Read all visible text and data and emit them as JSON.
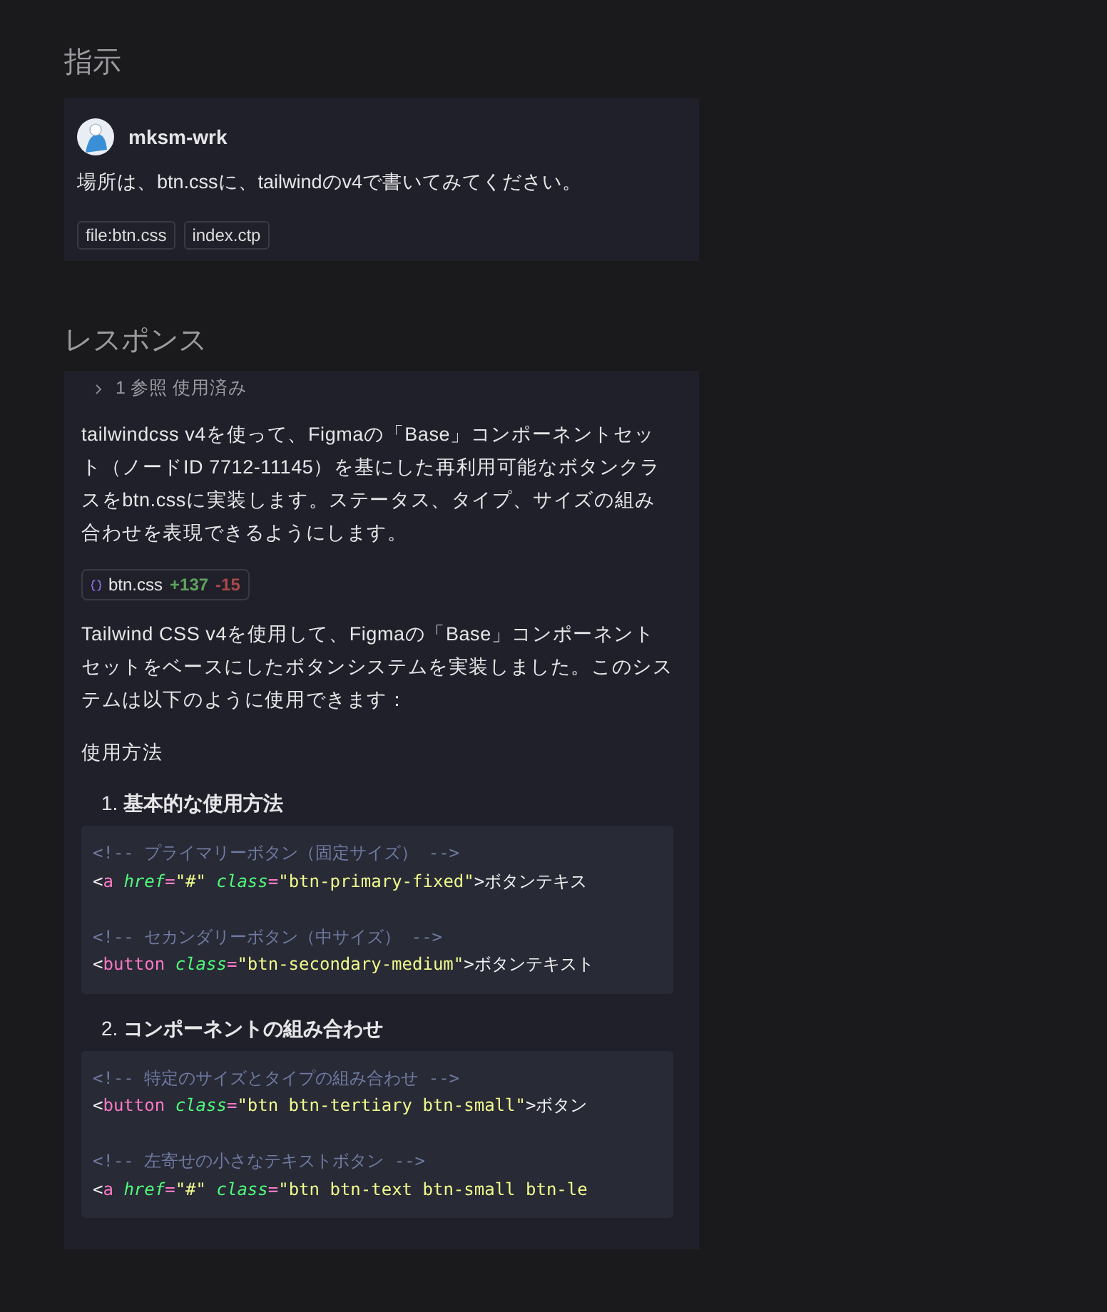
{
  "instruction": {
    "heading": "指示",
    "user": "mksm-wrk",
    "message": "場所は、btn.cssに、tailwindのv4で書いてみてください。",
    "tags": [
      "file:btn.css",
      "index.ctp"
    ]
  },
  "response": {
    "heading": "レスポンス",
    "references": {
      "label": "1 参照 使用済み",
      "expanded": false
    },
    "intro": "tailwindcss v4を使って、Figmaの「Base」コンポーネントセット（ノードID 7712-11145）を基にした再利用可能なボタンクラスをbtn.cssに実装します。ステータス、タイプ、サイズの組み合わせを表現できるようにします。",
    "file_change": {
      "name": "btn.css",
      "added": "+137",
      "removed": "-15"
    },
    "summary": "Tailwind CSS v4を使用して、Figmaの「Base」コンポーネントセットをベースにしたボタンシステムを実装しました。このシステムは以下のように使用できます：",
    "usage_heading": "使用方法",
    "sections": [
      {
        "number": "1.",
        "title": "基本的な使用方法",
        "code_groups": [
          [
            [
              {
                "kind": "comment",
                "text": "<!-- プライマリーボタン（固定サイズ） -->"
              }
            ],
            [
              {
                "kind": "punct",
                "text": "<"
              },
              {
                "kind": "tag",
                "text": "a"
              },
              {
                "kind": "attr",
                "text": " href"
              },
              {
                "kind": "op",
                "text": "="
              },
              {
                "kind": "string",
                "text": "\"#\""
              },
              {
                "kind": "attr",
                "text": " class"
              },
              {
                "kind": "op",
                "text": "="
              },
              {
                "kind": "string",
                "text": "\"btn-primary-fixed\""
              },
              {
                "kind": "punct",
                "text": ">ボタンテキス"
              }
            ]
          ],
          [
            [
              {
                "kind": "comment",
                "text": "<!-- セカンダリーボタン（中サイズ） -->"
              }
            ],
            [
              {
                "kind": "punct",
                "text": "<"
              },
              {
                "kind": "tag",
                "text": "button"
              },
              {
                "kind": "attr",
                "text": " class"
              },
              {
                "kind": "op",
                "text": "="
              },
              {
                "kind": "string",
                "text": "\"btn-secondary-medium\""
              },
              {
                "kind": "punct",
                "text": ">ボタンテキスト"
              }
            ]
          ]
        ]
      },
      {
        "number": "2.",
        "title": "コンポーネントの組み合わせ",
        "code_groups": [
          [
            [
              {
                "kind": "comment",
                "text": "<!-- 特定のサイズとタイプの組み合わせ -->"
              }
            ],
            [
              {
                "kind": "punct",
                "text": "<"
              },
              {
                "kind": "tag",
                "text": "button"
              },
              {
                "kind": "attr",
                "text": " class"
              },
              {
                "kind": "op",
                "text": "="
              },
              {
                "kind": "string",
                "text": "\"btn btn-tertiary btn-small\""
              },
              {
                "kind": "punct",
                "text": ">ボタン"
              }
            ]
          ],
          [
            [
              {
                "kind": "comment",
                "text": "<!-- 左寄せの小さなテキストボタン -->"
              }
            ],
            [
              {
                "kind": "punct",
                "text": "<"
              },
              {
                "kind": "tag",
                "text": "a"
              },
              {
                "kind": "attr",
                "text": " href"
              },
              {
                "kind": "op",
                "text": "="
              },
              {
                "kind": "string",
                "text": "\"#\""
              },
              {
                "kind": "attr",
                "text": " class"
              },
              {
                "kind": "op",
                "text": "="
              },
              {
                "kind": "string",
                "text": "\"btn btn-text btn-small btn-le"
              }
            ]
          ]
        ]
      }
    ]
  }
}
